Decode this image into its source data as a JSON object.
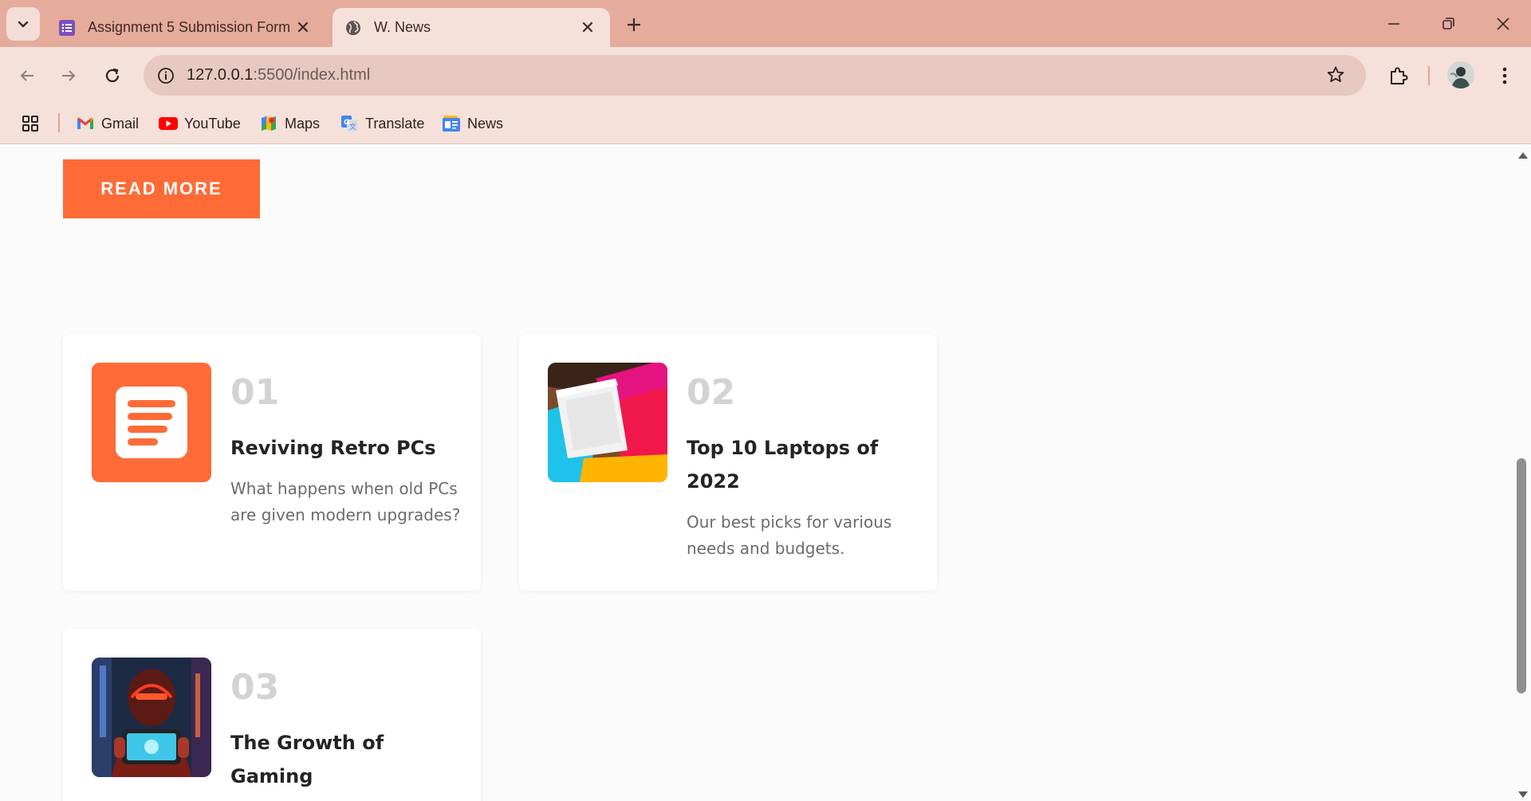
{
  "browser": {
    "tabs": [
      {
        "title": "Assignment 5 Submission Form",
        "icon": "google-forms-icon",
        "active": false
      },
      {
        "title": "W. News",
        "icon": "globe-icon",
        "active": true
      }
    ],
    "url_host": "127.0.0.1",
    "url_path": ":5500/index.html",
    "bookmarks": [
      {
        "label": "Gmail",
        "icon": "gmail-icon"
      },
      {
        "label": "YouTube",
        "icon": "youtube-icon"
      },
      {
        "label": "Maps",
        "icon": "maps-icon"
      },
      {
        "label": "Translate",
        "icon": "translate-icon"
      },
      {
        "label": "News",
        "icon": "news-icon"
      }
    ]
  },
  "page": {
    "read_more_label": "READ MORE",
    "accent_color": "#fe6b37",
    "cards": [
      {
        "number": "01",
        "title": "Reviving Retro PCs",
        "description": "What happens when old PCs are given modern upgrades?",
        "image": "document-icon"
      },
      {
        "number": "02",
        "title": "Top 10 Laptops of 2022",
        "description": "Our best picks for various needs and budgets.",
        "image": "laptops-photo"
      },
      {
        "number": "03",
        "title": "The Growth of Gaming",
        "description": "",
        "image": "gaming-photo"
      }
    ]
  }
}
